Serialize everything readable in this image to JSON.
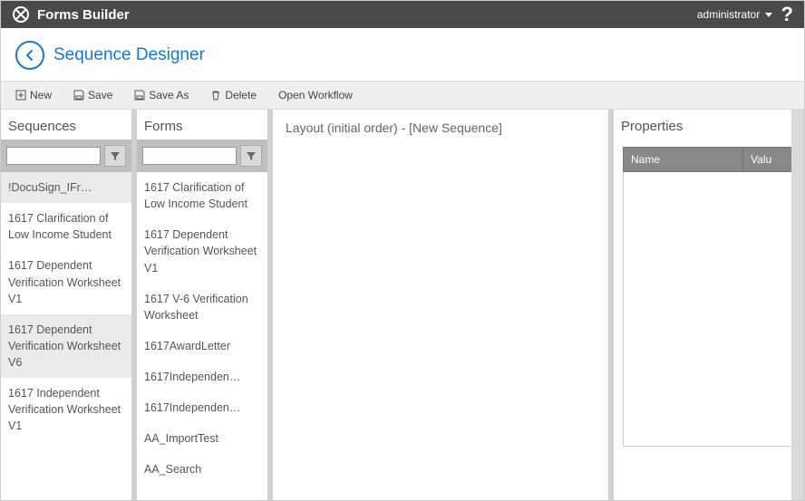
{
  "header": {
    "app_name": "Forms Builder",
    "user_label": "administrator"
  },
  "page": {
    "title": "Sequence Designer"
  },
  "toolbar": {
    "new": "New",
    "save": "Save",
    "save_as": "Save As",
    "delete": "Delete",
    "open_workflow": "Open Workflow"
  },
  "sequences": {
    "title": "Sequences",
    "search_value": "",
    "search_placeholder": "",
    "items": [
      "!DocuSign_IFr…",
      "1617 Clarification of Low Income Student",
      "1617 Dependent Verification Worksheet V1",
      "1617 Dependent Verification Worksheet V6",
      "1617 Independent Verification Worksheet V1"
    ]
  },
  "forms": {
    "title": "Forms",
    "search_value": "",
    "search_placeholder": "",
    "items": [
      "1617 Clarification of Low Income Student",
      "1617 Dependent Verification Worksheet V1",
      "1617 V-6 Verification Worksheet",
      "1617AwardLetter",
      "1617Independen…",
      "1617Independen…",
      "AA_ImportTest",
      "AA_Search"
    ]
  },
  "layout": {
    "title": "Layout (initial order) - [New Sequence]"
  },
  "properties": {
    "title": "Properties",
    "col_name": "Name",
    "col_value": "Valu"
  }
}
